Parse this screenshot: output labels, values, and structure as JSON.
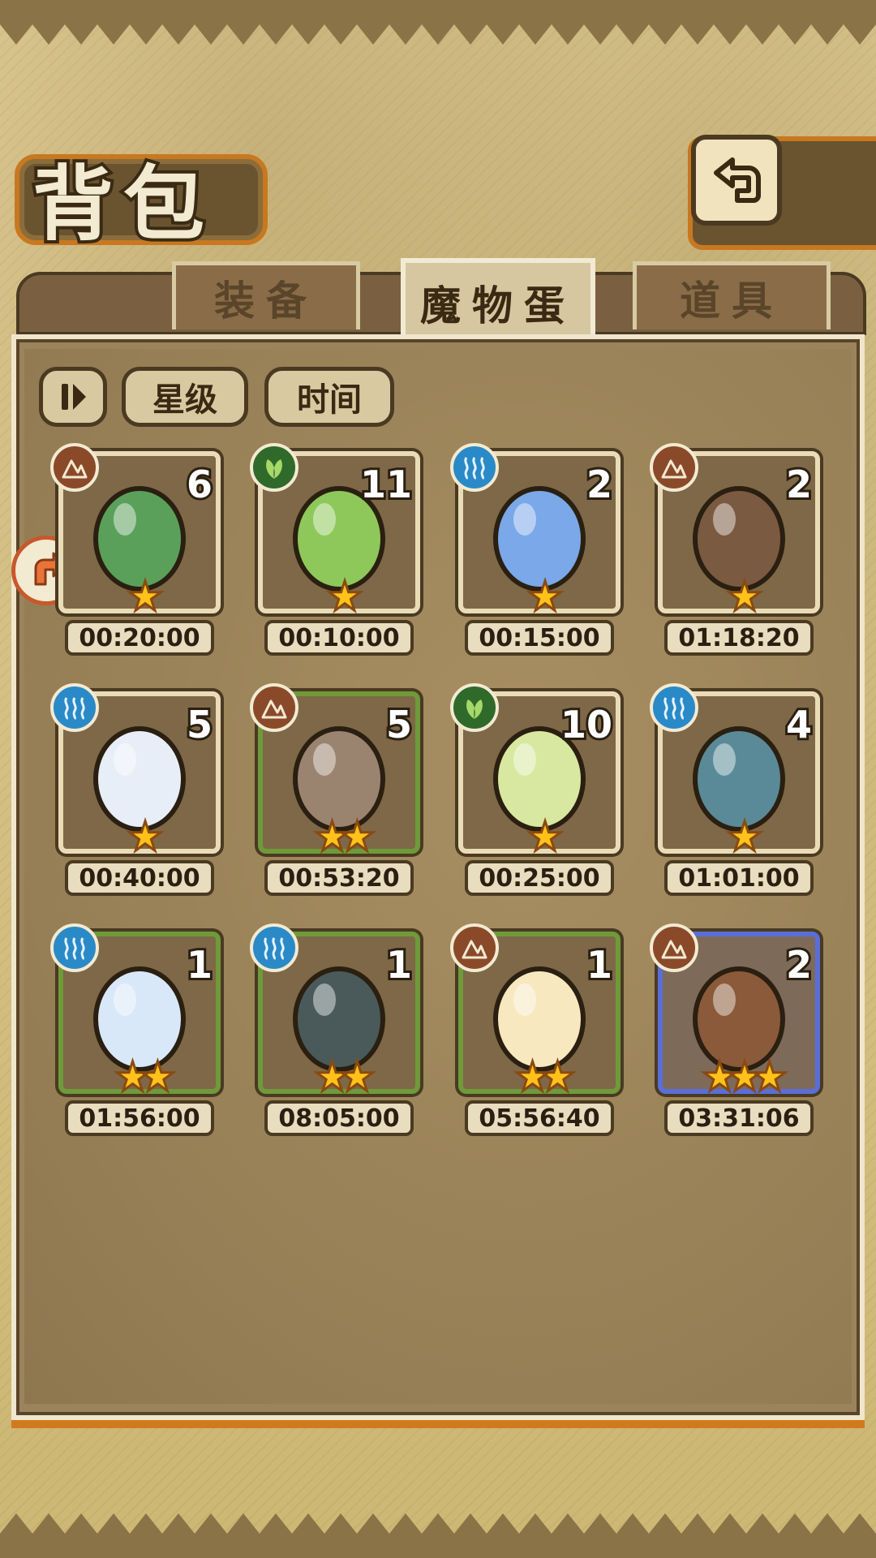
{
  "header": {
    "title": "背包"
  },
  "tabs": [
    {
      "label": "装备",
      "active": false
    },
    {
      "label": "魔物蛋",
      "active": true
    },
    {
      "label": "道具",
      "active": false
    }
  ],
  "filters": {
    "sort_icon": "sort-toggle-icon",
    "star_label": "星级",
    "time_label": "时间"
  },
  "colors": {
    "earth": "#8a4a2a",
    "wood": "#2f6a2a",
    "water": "#2a8ac8",
    "star": "#ffc21a"
  },
  "eggs": [
    {
      "element": "earth",
      "count": "6",
      "stars": "★",
      "time": "00:20:00",
      "frame": "plain"
    },
    {
      "element": "wood",
      "count": "11",
      "stars": "★",
      "time": "00:10:00",
      "frame": "plain"
    },
    {
      "element": "water",
      "count": "2",
      "stars": "★",
      "time": "00:15:00",
      "frame": "plain"
    },
    {
      "element": "earth",
      "count": "2",
      "stars": "★",
      "time": "01:18:20",
      "frame": "plain"
    },
    {
      "element": "water",
      "count": "5",
      "stars": "★",
      "time": "00:40:00",
      "frame": "plain"
    },
    {
      "element": "earth",
      "count": "5",
      "stars": "★★",
      "time": "00:53:20",
      "frame": "green"
    },
    {
      "element": "wood",
      "count": "10",
      "stars": "★",
      "time": "00:25:00",
      "frame": "plain"
    },
    {
      "element": "water",
      "count": "4",
      "stars": "★",
      "time": "01:01:00",
      "frame": "plain"
    },
    {
      "element": "water",
      "count": "1",
      "stars": "★★",
      "time": "01:56:00",
      "frame": "green"
    },
    {
      "element": "water",
      "count": "1",
      "stars": "★★",
      "time": "08:05:00",
      "frame": "green"
    },
    {
      "element": "earth",
      "count": "1",
      "stars": "★★",
      "time": "05:56:40",
      "frame": "green"
    },
    {
      "element": "earth",
      "count": "2",
      "stars": "★★★",
      "time": "03:31:06",
      "frame": "blue"
    }
  ]
}
